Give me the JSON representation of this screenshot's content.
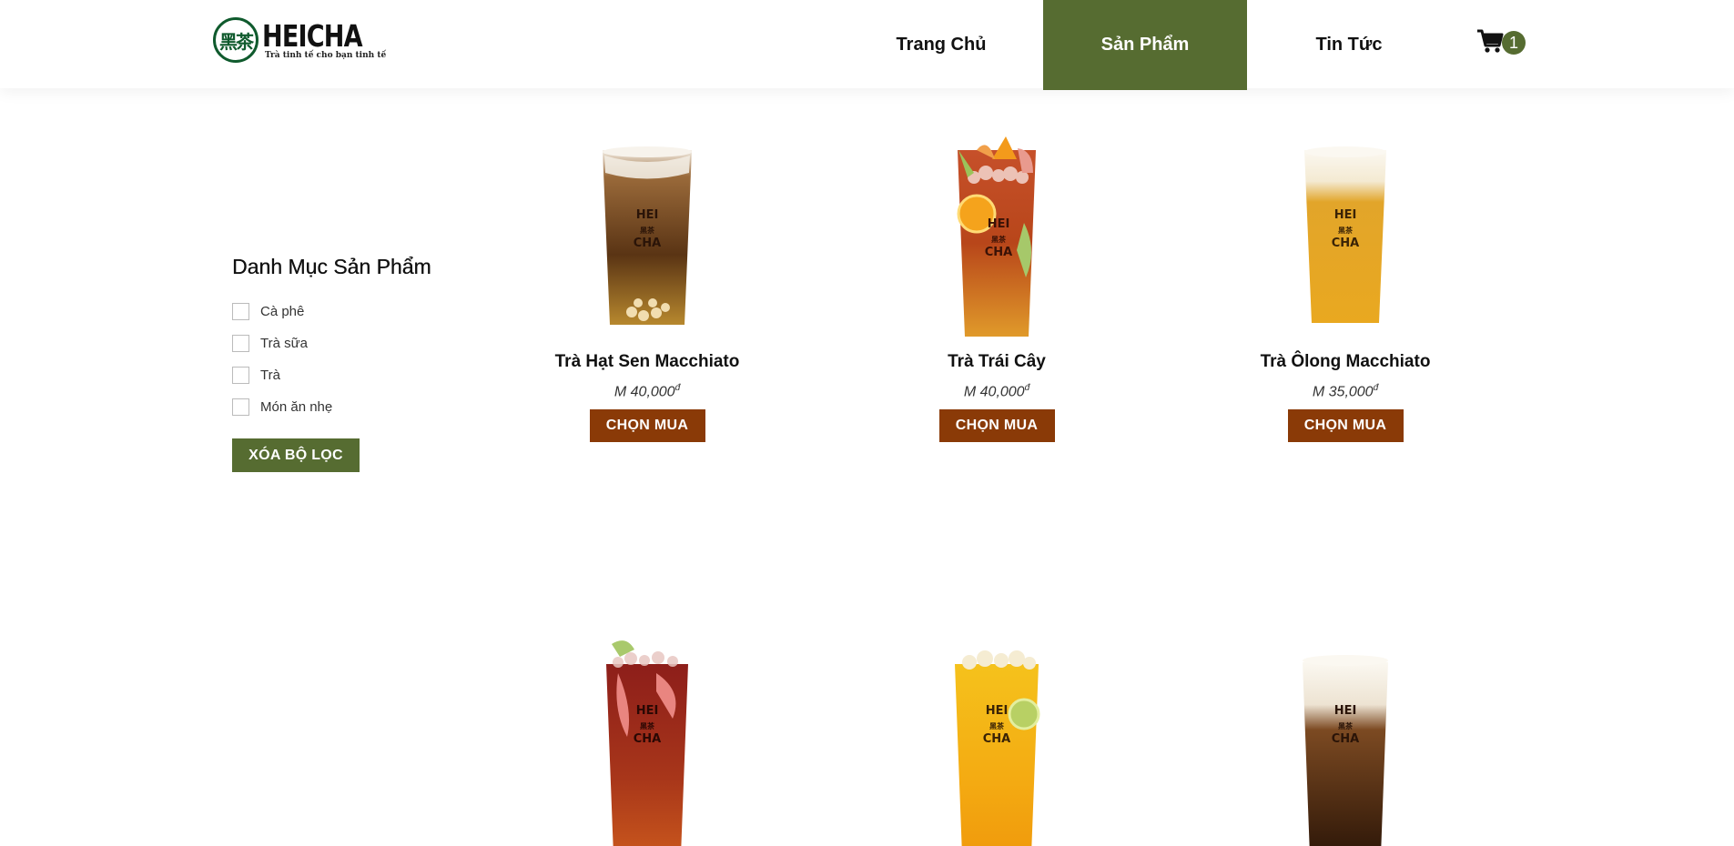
{
  "brand": {
    "logo_mark": "黑茶",
    "name": "HEICHA",
    "tagline": "Trà tinh tế cho bạn tinh tế"
  },
  "nav": {
    "items": [
      {
        "label": "Trang Chủ",
        "active": false
      },
      {
        "label": "Sản Phẩm",
        "active": true
      },
      {
        "label": "Tin Tức",
        "active": false
      }
    ],
    "cart_count": "1"
  },
  "sidebar": {
    "title": "Danh Mục Sản Phẩm",
    "filters": [
      {
        "label": "Cà phê",
        "checked": false
      },
      {
        "label": "Trà sữa",
        "checked": false
      },
      {
        "label": "Trà",
        "checked": false
      },
      {
        "label": "Món ăn nhẹ",
        "checked": false
      }
    ],
    "clear_label": "XÓA BỘ LỌC"
  },
  "products": [
    {
      "name": "Trà Hạt Sen Macchiato",
      "size": "M",
      "price": "40,000",
      "currency": "đ",
      "buy_label": "CHỌN MUA"
    },
    {
      "name": "Trà Trái Cây",
      "size": "M",
      "price": "40,000",
      "currency": "đ",
      "buy_label": "CHỌN MUA"
    },
    {
      "name": "Trà Ôlong Macchiato",
      "size": "M",
      "price": "35,000",
      "currency": "đ",
      "buy_label": "CHỌN MUA"
    },
    {
      "name": "",
      "size": "",
      "price": "",
      "currency": "",
      "buy_label": ""
    },
    {
      "name": "",
      "size": "",
      "price": "",
      "currency": "",
      "buy_label": ""
    },
    {
      "name": "",
      "size": "",
      "price": "",
      "currency": "",
      "buy_label": ""
    }
  ],
  "cup_print": {
    "line1": "HEI",
    "line2": "CHA",
    "mark": "黑茶"
  },
  "colors": {
    "brand_green": "#566c31",
    "buy_button": "#8a3a07",
    "logo_green": "#0f5a2d"
  }
}
